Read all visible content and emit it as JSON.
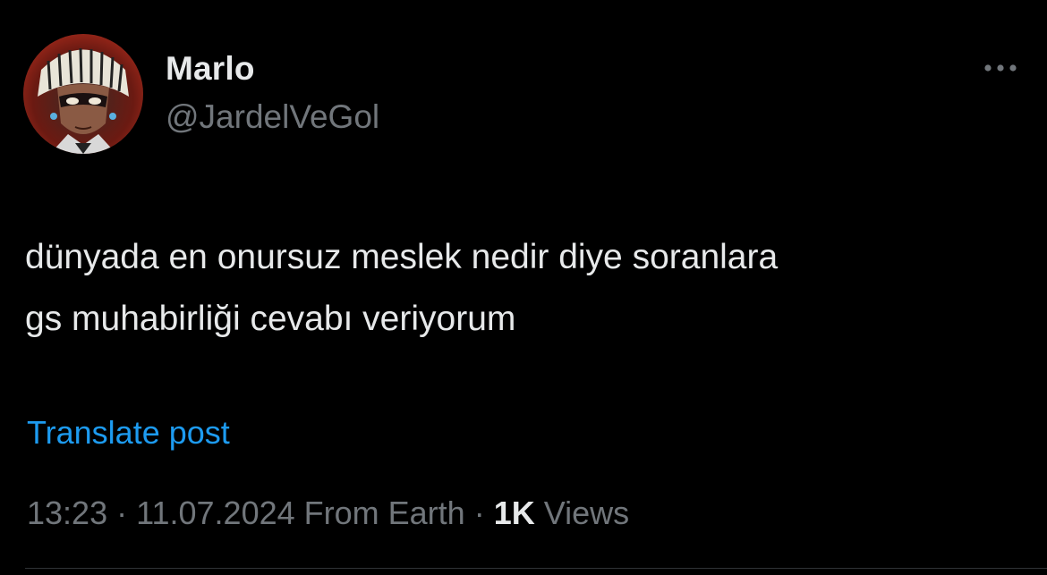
{
  "user": {
    "display_name": "Marlo",
    "handle": "@JardelVeGol"
  },
  "tweet": {
    "text": "dünyada en onursuz meslek nedir diye soranlara\ngs muhabirliği cevabı veriyorum",
    "translate_label": "Translate post"
  },
  "meta": {
    "time": "13:23",
    "separator": "·",
    "date": "11.07.2024",
    "location": "From Earth",
    "views_count": "1K",
    "views_label": "Views"
  },
  "icons": {
    "more": "more-horizontal-icon",
    "avatar": "avatar-image"
  },
  "colors": {
    "background": "#000000",
    "primary_text": "#e7e9ea",
    "secondary_text": "#71767b",
    "link": "#1d9bf0"
  }
}
